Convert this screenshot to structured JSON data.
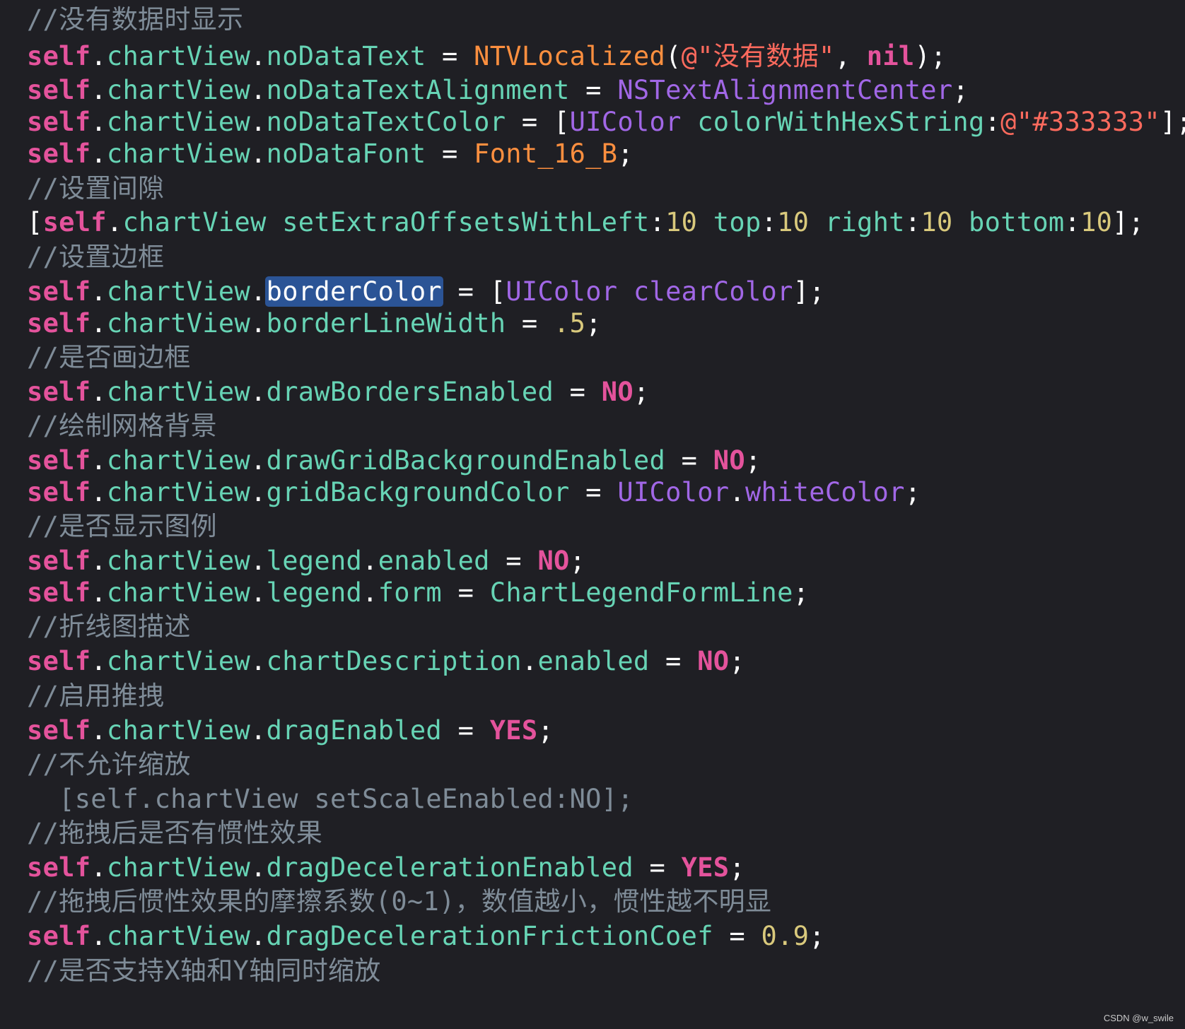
{
  "theme": {
    "background": "#1f1f24",
    "keyword": "#e4539c",
    "property": "#67d4b5",
    "string": "#fc6a5d",
    "number": "#d9c97c",
    "macro": "#fd8f3f",
    "type": "#a167e6",
    "comment": "#7f8c98",
    "selection": "#2b5496"
  },
  "lines": [
    [
      {
        "t": "comment",
        "v": "//没有数据时显示"
      }
    ],
    [
      {
        "t": "self",
        "v": "self"
      },
      {
        "t": "plain",
        "v": "."
      },
      {
        "t": "prop",
        "v": "chartView"
      },
      {
        "t": "plain",
        "v": "."
      },
      {
        "t": "prop",
        "v": "noDataText"
      },
      {
        "t": "plain",
        "v": " = "
      },
      {
        "t": "macro",
        "v": "NTVLocalized"
      },
      {
        "t": "plain",
        "v": "("
      },
      {
        "t": "string",
        "v": "@\"没有数据\""
      },
      {
        "t": "plain",
        "v": ", "
      },
      {
        "t": "nil",
        "v": "nil"
      },
      {
        "t": "plain",
        "v": ");"
      }
    ],
    [
      {
        "t": "self",
        "v": "self"
      },
      {
        "t": "plain",
        "v": "."
      },
      {
        "t": "prop",
        "v": "chartView"
      },
      {
        "t": "plain",
        "v": "."
      },
      {
        "t": "prop",
        "v": "noDataTextAlignment"
      },
      {
        "t": "plain",
        "v": " = "
      },
      {
        "t": "type",
        "v": "NSTextAlignmentCenter"
      },
      {
        "t": "plain",
        "v": ";"
      }
    ],
    [
      {
        "t": "self",
        "v": "self"
      },
      {
        "t": "plain",
        "v": "."
      },
      {
        "t": "prop",
        "v": "chartView"
      },
      {
        "t": "plain",
        "v": "."
      },
      {
        "t": "prop",
        "v": "noDataTextColor"
      },
      {
        "t": "plain",
        "v": " = ["
      },
      {
        "t": "type",
        "v": "UIColor"
      },
      {
        "t": "plain",
        "v": " "
      },
      {
        "t": "method",
        "v": "colorWithHexString"
      },
      {
        "t": "plain",
        "v": ":"
      },
      {
        "t": "string",
        "v": "@\"#333333\""
      },
      {
        "t": "plain",
        "v": "];"
      }
    ],
    [
      {
        "t": "self",
        "v": "self"
      },
      {
        "t": "plain",
        "v": "."
      },
      {
        "t": "prop",
        "v": "chartView"
      },
      {
        "t": "plain",
        "v": "."
      },
      {
        "t": "prop",
        "v": "noDataFont"
      },
      {
        "t": "plain",
        "v": " = "
      },
      {
        "t": "macro",
        "v": "Font_16_B"
      },
      {
        "t": "plain",
        "v": ";"
      }
    ],
    [
      {
        "t": "comment",
        "v": "//设置间隙"
      }
    ],
    [
      {
        "t": "plain",
        "v": "["
      },
      {
        "t": "self",
        "v": "self"
      },
      {
        "t": "plain",
        "v": "."
      },
      {
        "t": "prop",
        "v": "chartView"
      },
      {
        "t": "plain",
        "v": " "
      },
      {
        "t": "method",
        "v": "setExtraOffsetsWithLeft"
      },
      {
        "t": "plain",
        "v": ":"
      },
      {
        "t": "number",
        "v": "10"
      },
      {
        "t": "plain",
        "v": " "
      },
      {
        "t": "method",
        "v": "top"
      },
      {
        "t": "plain",
        "v": ":"
      },
      {
        "t": "number",
        "v": "10"
      },
      {
        "t": "plain",
        "v": " "
      },
      {
        "t": "method",
        "v": "right"
      },
      {
        "t": "plain",
        "v": ":"
      },
      {
        "t": "number",
        "v": "10"
      },
      {
        "t": "plain",
        "v": " "
      },
      {
        "t": "method",
        "v": "bottom"
      },
      {
        "t": "plain",
        "v": ":"
      },
      {
        "t": "number",
        "v": "10"
      },
      {
        "t": "plain",
        "v": "];"
      }
    ],
    [
      {
        "t": "comment",
        "v": "//设置边框"
      }
    ],
    [
      {
        "t": "self",
        "v": "self"
      },
      {
        "t": "plain",
        "v": "."
      },
      {
        "t": "prop",
        "v": "chartView"
      },
      {
        "t": "plain",
        "v": "."
      },
      {
        "t": "selected",
        "v": "borderColor"
      },
      {
        "t": "plain",
        "v": " = ["
      },
      {
        "t": "type",
        "v": "UIColor"
      },
      {
        "t": "plain",
        "v": " "
      },
      {
        "t": "type",
        "v": "clearColor"
      },
      {
        "t": "plain",
        "v": "];"
      }
    ],
    [
      {
        "t": "self",
        "v": "self"
      },
      {
        "t": "plain",
        "v": "."
      },
      {
        "t": "prop",
        "v": "chartView"
      },
      {
        "t": "plain",
        "v": "."
      },
      {
        "t": "prop",
        "v": "borderLineWidth"
      },
      {
        "t": "plain",
        "v": " = "
      },
      {
        "t": "number",
        "v": ".5"
      },
      {
        "t": "plain",
        "v": ";"
      }
    ],
    [
      {
        "t": "comment",
        "v": "//是否画边框"
      }
    ],
    [
      {
        "t": "self",
        "v": "self"
      },
      {
        "t": "plain",
        "v": "."
      },
      {
        "t": "prop",
        "v": "chartView"
      },
      {
        "t": "plain",
        "v": "."
      },
      {
        "t": "prop",
        "v": "drawBordersEnabled"
      },
      {
        "t": "plain",
        "v": " = "
      },
      {
        "t": "bool",
        "v": "NO"
      },
      {
        "t": "plain",
        "v": ";"
      }
    ],
    [
      {
        "t": "comment",
        "v": "//绘制网格背景"
      }
    ],
    [
      {
        "t": "self",
        "v": "self"
      },
      {
        "t": "plain",
        "v": "."
      },
      {
        "t": "prop",
        "v": "chartView"
      },
      {
        "t": "plain",
        "v": "."
      },
      {
        "t": "prop",
        "v": "drawGridBackgroundEnabled"
      },
      {
        "t": "plain",
        "v": " = "
      },
      {
        "t": "bool",
        "v": "NO"
      },
      {
        "t": "plain",
        "v": ";"
      }
    ],
    [
      {
        "t": "self",
        "v": "self"
      },
      {
        "t": "plain",
        "v": "."
      },
      {
        "t": "prop",
        "v": "chartView"
      },
      {
        "t": "plain",
        "v": "."
      },
      {
        "t": "prop",
        "v": "gridBackgroundColor"
      },
      {
        "t": "plain",
        "v": " = "
      },
      {
        "t": "type",
        "v": "UIColor"
      },
      {
        "t": "plain",
        "v": "."
      },
      {
        "t": "type",
        "v": "whiteColor"
      },
      {
        "t": "plain",
        "v": ";"
      }
    ],
    [
      {
        "t": "comment",
        "v": "//是否显示图例"
      }
    ],
    [
      {
        "t": "self",
        "v": "self"
      },
      {
        "t": "plain",
        "v": "."
      },
      {
        "t": "prop",
        "v": "chartView"
      },
      {
        "t": "plain",
        "v": "."
      },
      {
        "t": "prop",
        "v": "legend"
      },
      {
        "t": "plain",
        "v": "."
      },
      {
        "t": "prop",
        "v": "enabled"
      },
      {
        "t": "plain",
        "v": " = "
      },
      {
        "t": "bool",
        "v": "NO"
      },
      {
        "t": "plain",
        "v": ";"
      }
    ],
    [
      {
        "t": "self",
        "v": "self"
      },
      {
        "t": "plain",
        "v": "."
      },
      {
        "t": "prop",
        "v": "chartView"
      },
      {
        "t": "plain",
        "v": "."
      },
      {
        "t": "prop",
        "v": "legend"
      },
      {
        "t": "plain",
        "v": "."
      },
      {
        "t": "prop",
        "v": "form"
      },
      {
        "t": "plain",
        "v": " = "
      },
      {
        "t": "prop",
        "v": "ChartLegendFormLine"
      },
      {
        "t": "plain",
        "v": ";"
      }
    ],
    [
      {
        "t": "comment",
        "v": "//折线图描述"
      }
    ],
    [
      {
        "t": "self",
        "v": "self"
      },
      {
        "t": "plain",
        "v": "."
      },
      {
        "t": "prop",
        "v": "chartView"
      },
      {
        "t": "plain",
        "v": "."
      },
      {
        "t": "prop",
        "v": "chartDescription"
      },
      {
        "t": "plain",
        "v": "."
      },
      {
        "t": "prop",
        "v": "enabled"
      },
      {
        "t": "plain",
        "v": " = "
      },
      {
        "t": "bool",
        "v": "NO"
      },
      {
        "t": "plain",
        "v": ";"
      }
    ],
    [
      {
        "t": "comment",
        "v": "//启用推拽"
      }
    ],
    [
      {
        "t": "self",
        "v": "self"
      },
      {
        "t": "plain",
        "v": "."
      },
      {
        "t": "prop",
        "v": "chartView"
      },
      {
        "t": "plain",
        "v": "."
      },
      {
        "t": "prop",
        "v": "dragEnabled"
      },
      {
        "t": "plain",
        "v": " = "
      },
      {
        "t": "bool",
        "v": "YES"
      },
      {
        "t": "plain",
        "v": ";"
      }
    ],
    [
      {
        "t": "comment",
        "v": "//不允许缩放"
      }
    ],
    [
      {
        "t": "disabled",
        "v": "  [self.chartView setScaleEnabled:NO];"
      }
    ],
    [
      {
        "t": "comment",
        "v": "//拖拽后是否有惯性效果"
      }
    ],
    [
      {
        "t": "self",
        "v": "self"
      },
      {
        "t": "plain",
        "v": "."
      },
      {
        "t": "prop",
        "v": "chartView"
      },
      {
        "t": "plain",
        "v": "."
      },
      {
        "t": "prop",
        "v": "dragDecelerationEnabled"
      },
      {
        "t": "plain",
        "v": " = "
      },
      {
        "t": "bool",
        "v": "YES"
      },
      {
        "t": "plain",
        "v": ";"
      }
    ],
    [
      {
        "t": "comment",
        "v": "//拖拽后惯性效果的摩擦系数(0~1)，数值越小，惯性越不明显"
      }
    ],
    [
      {
        "t": "self",
        "v": "self"
      },
      {
        "t": "plain",
        "v": "."
      },
      {
        "t": "prop",
        "v": "chartView"
      },
      {
        "t": "plain",
        "v": "."
      },
      {
        "t": "prop",
        "v": "dragDecelerationFrictionCoef"
      },
      {
        "t": "plain",
        "v": " = "
      },
      {
        "t": "number",
        "v": "0.9"
      },
      {
        "t": "plain",
        "v": ";"
      }
    ],
    [
      {
        "t": "comment",
        "v": "//是否支持X轴和Y轴同时缩放"
      }
    ]
  ],
  "watermark": "CSDN @w_swile"
}
